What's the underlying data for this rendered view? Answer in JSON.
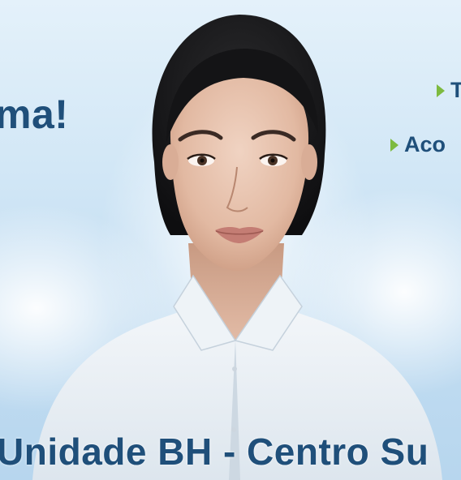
{
  "headline": "ma!",
  "bullets": [
    {
      "text": "T",
      "icon": "triangle-bullet-icon"
    },
    {
      "text": "Aco",
      "icon": "triangle-bullet-icon"
    }
  ],
  "location_title": "Unidade BH - Centro Su",
  "colors": {
    "text_blue": "#1f4f7a",
    "bullet_green": "#7dba3f",
    "background_light_blue": "#d2e7f6"
  }
}
